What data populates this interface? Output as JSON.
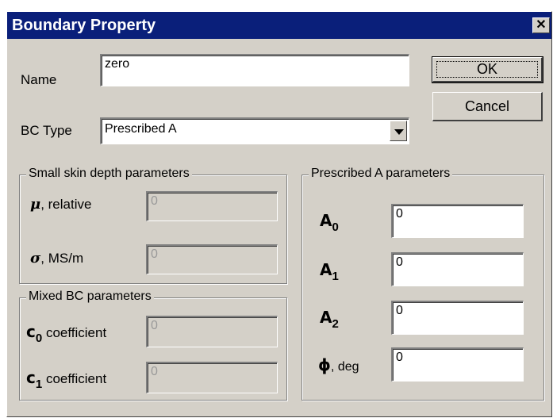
{
  "window": {
    "title": "Boundary Property",
    "close_glyph": "✕"
  },
  "name_field": {
    "label": "Name",
    "value": "zero"
  },
  "buttons": {
    "ok": "OK",
    "cancel": "Cancel"
  },
  "bc_type": {
    "label": "BC Type",
    "selected": "Prescribed A"
  },
  "small_skin": {
    "title": "Small skin depth parameters",
    "mu": {
      "symbol": "μ",
      "label": ", relative",
      "value": "0"
    },
    "sigma": {
      "symbol": "σ",
      "label": ", MS/m",
      "value": "0"
    }
  },
  "mixed_bc": {
    "title": "Mixed BC parameters",
    "c0": {
      "symbol": "c",
      "sub": "0",
      "label": "coefficient",
      "value": "0"
    },
    "c1": {
      "symbol": "c",
      "sub": "1",
      "label": "coefficient",
      "value": "0"
    }
  },
  "prescribed_a": {
    "title": "Prescribed A parameters",
    "a0": {
      "symbol": "A",
      "sub": "0",
      "value": "0"
    },
    "a1": {
      "symbol": "A",
      "sub": "1",
      "value": "0"
    },
    "a2": {
      "symbol": "A",
      "sub": "2",
      "value": "0"
    },
    "phi": {
      "symbol": "ϕ",
      "label": ", deg",
      "value": "0"
    }
  }
}
